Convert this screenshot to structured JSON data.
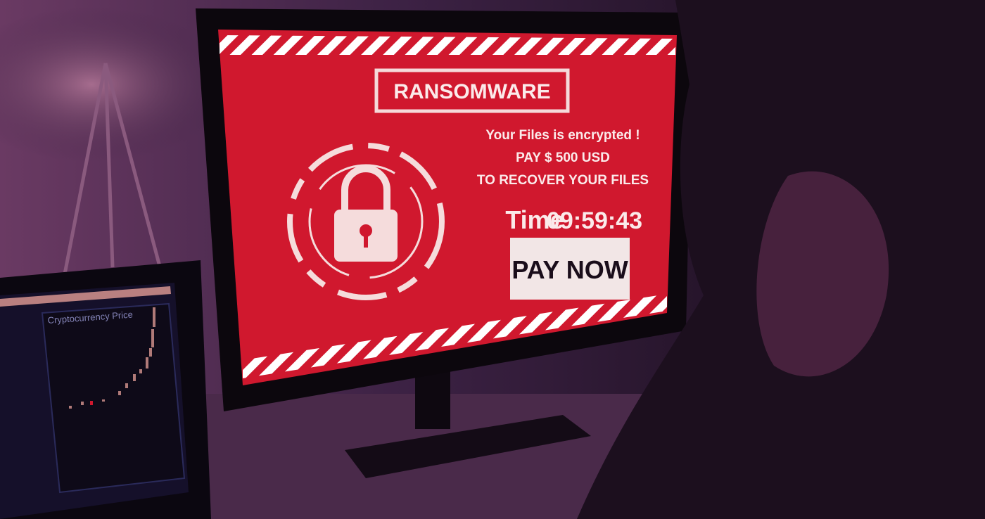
{
  "ransom_screen": {
    "title": "RANSOMWARE",
    "line1": "Your Files is encrypted !",
    "line2": "PAY $ 500 USD",
    "line3": "TO RECOVER YOUR FILES",
    "timer_label": "Time",
    "timer_value": "09:59:43",
    "pay_button": "PAY NOW",
    "lock_icon": "padlock-icon"
  },
  "laptop": {
    "chart_title": "Cryptocurrency Price"
  },
  "colors": {
    "screen_red": "#d0182e",
    "background": "#1a0d22",
    "button_bg": "#f2e6e6"
  }
}
